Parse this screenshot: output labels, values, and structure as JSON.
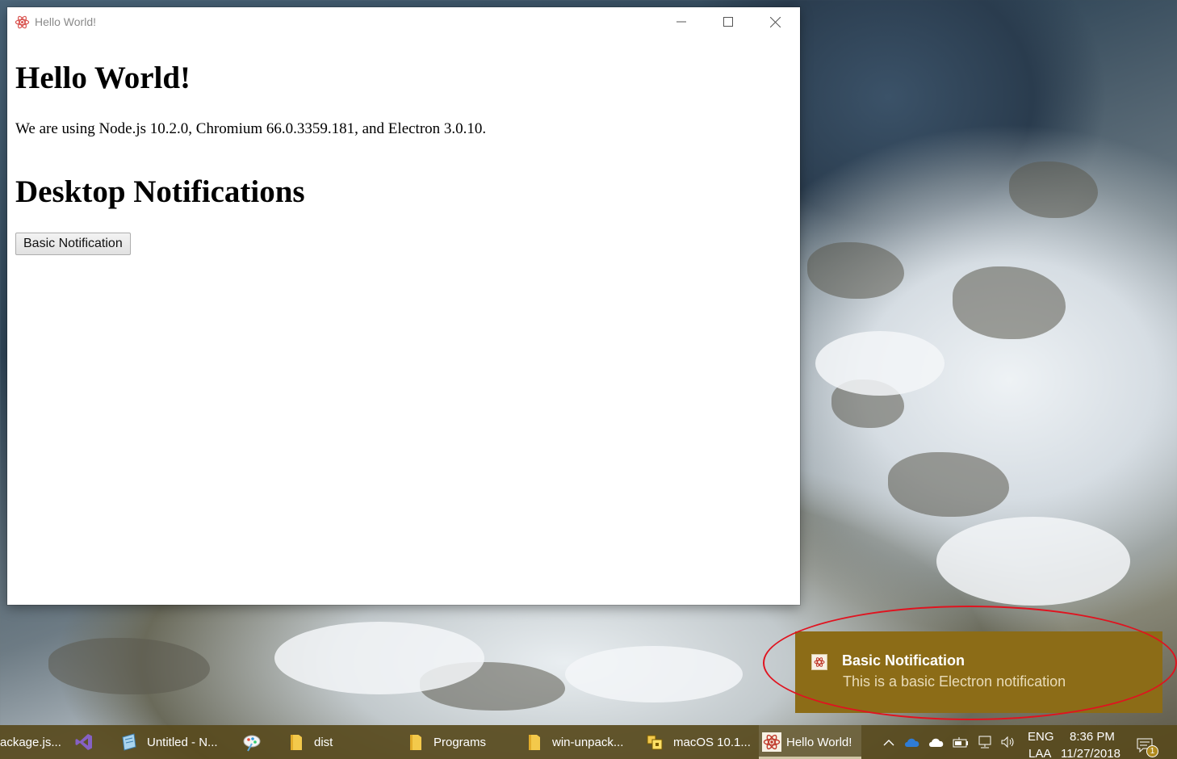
{
  "window": {
    "title": "Hello World!",
    "minimize_icon": "minimize-icon",
    "maximize_icon": "maximize-icon",
    "close_icon": "close-icon"
  },
  "page": {
    "heading": "Hello World!",
    "versions_text": "We are using Node.js 10.2.0, Chromium 66.0.3359.181, and Electron 3.0.10.",
    "section_heading": "Desktop Notifications",
    "button_label": "Basic Notification"
  },
  "toast": {
    "title": "Basic Notification",
    "body": "This is a basic Electron notification",
    "annotation_color": "#e0131f",
    "background": "#8c6c17"
  },
  "taskbar": {
    "items": [
      {
        "label": "ackage.js...",
        "icon": "file-icon"
      },
      {
        "label": "",
        "icon": "visual-studio-icon"
      },
      {
        "label": "Untitled - N...",
        "icon": "notepad-icon"
      },
      {
        "label": "",
        "icon": "paint-icon"
      },
      {
        "label": "dist",
        "icon": "folder-icon"
      },
      {
        "label": "Programs",
        "icon": "folder-icon"
      },
      {
        "label": "win-unpack...",
        "icon": "folder-icon"
      },
      {
        "label": "macOS 10.1...",
        "icon": "vmware-icon"
      },
      {
        "label": "Hello World!",
        "icon": "electron-icon"
      }
    ],
    "tray": {
      "language_top": "ENG",
      "language_bottom": "LAA",
      "time": "8:36 PM",
      "date": "11/27/2018",
      "notification_count": "1"
    }
  }
}
